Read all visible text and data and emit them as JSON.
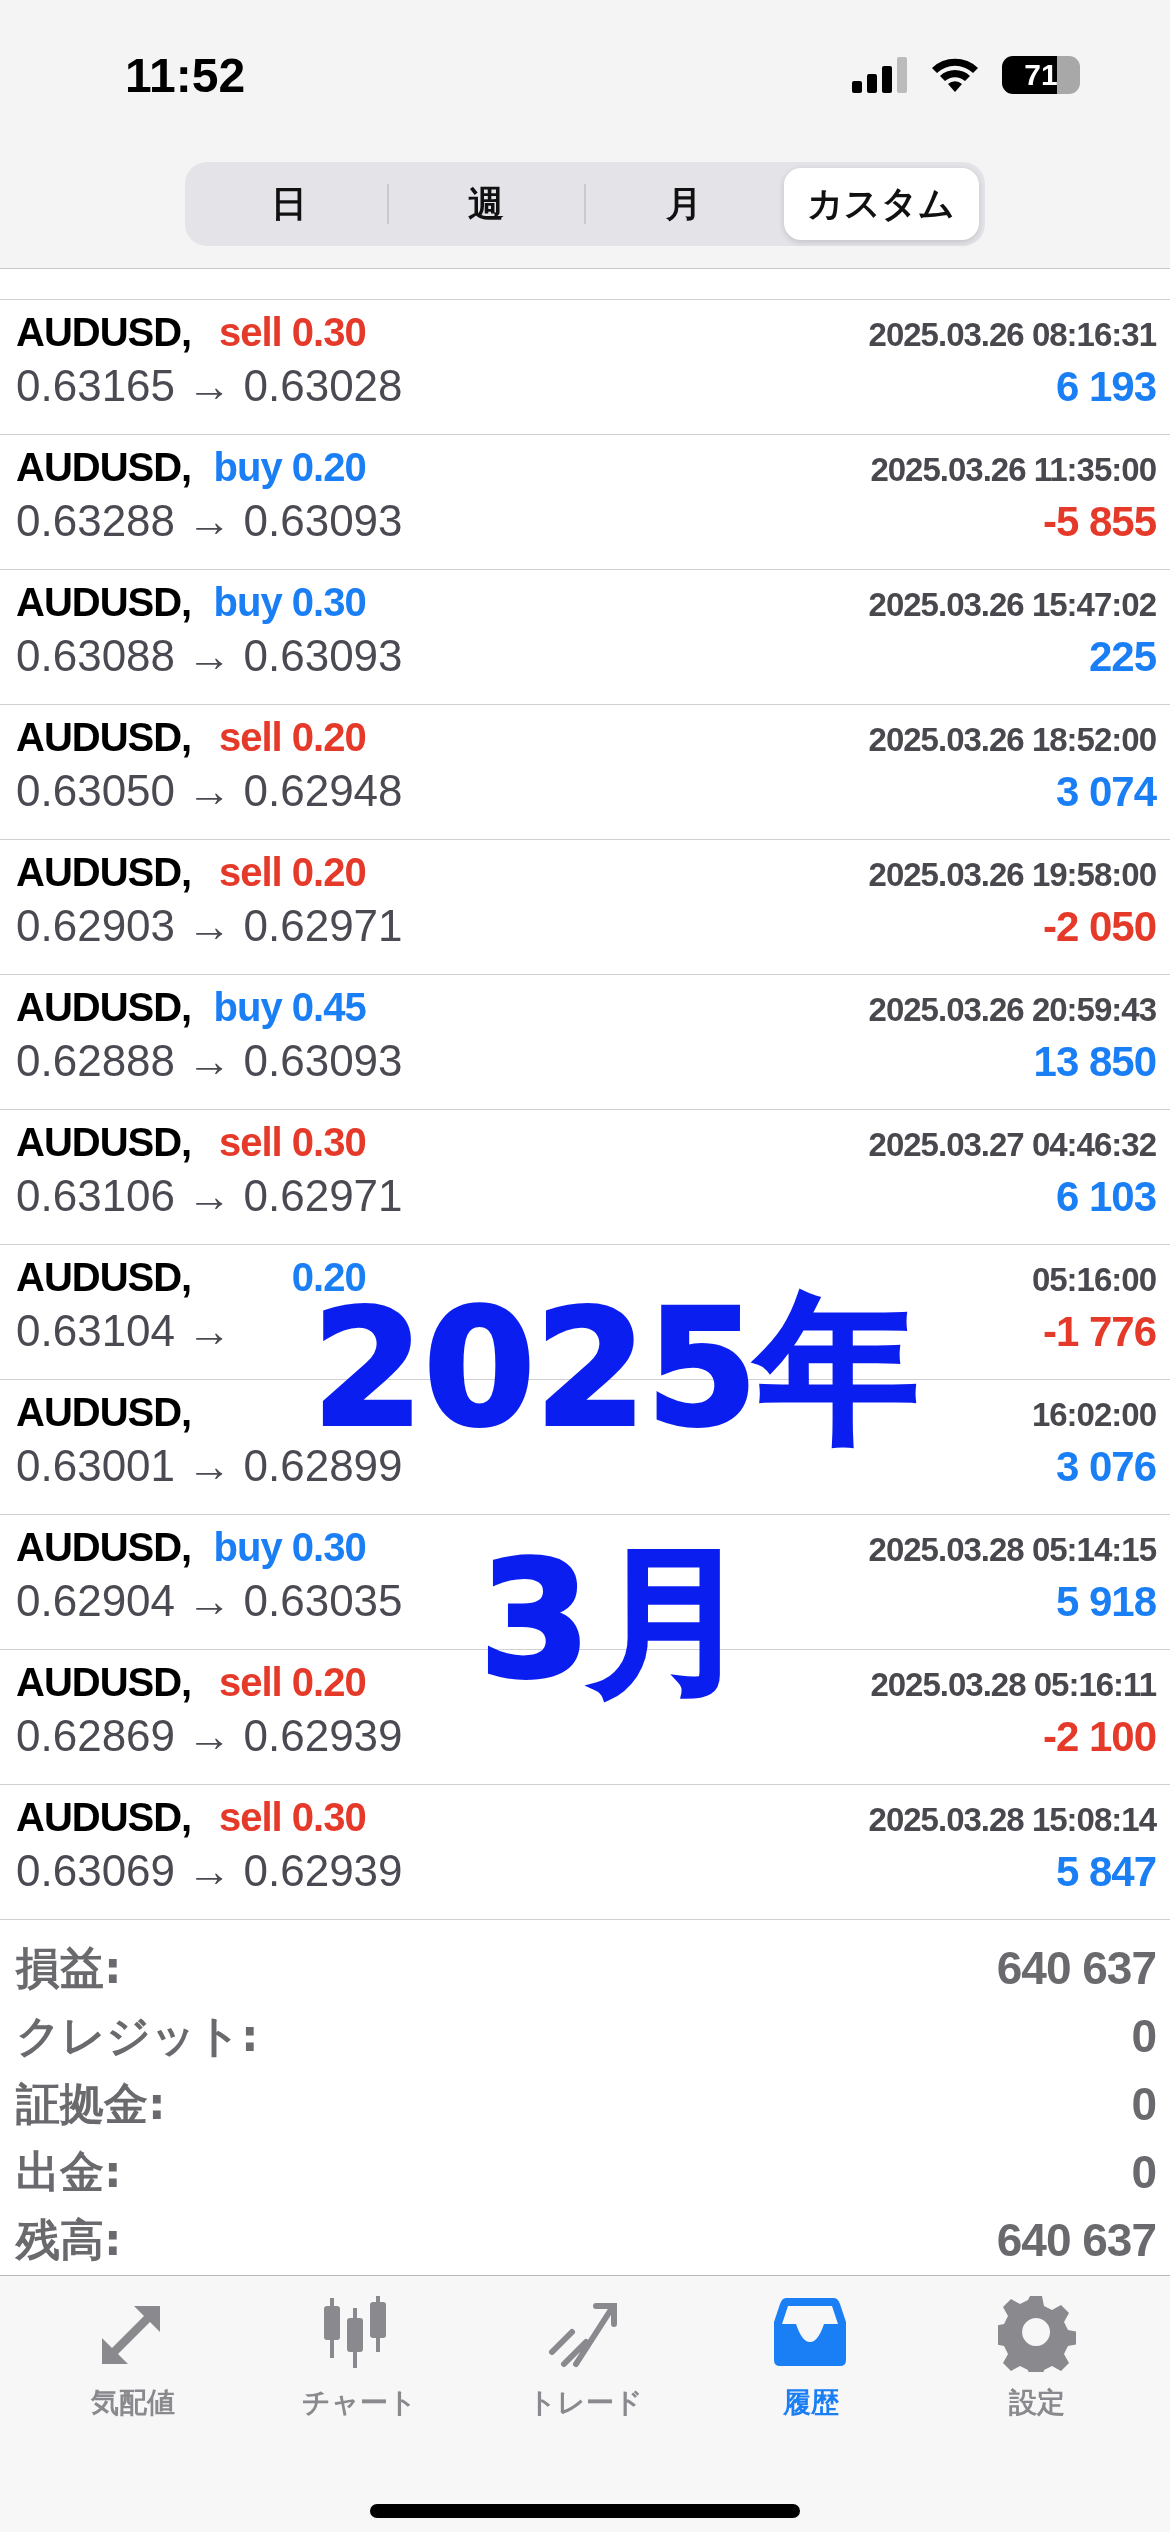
{
  "status_bar": {
    "time": "11:52",
    "battery": "71"
  },
  "period_tabs": [
    {
      "label": "日",
      "selected": false
    },
    {
      "label": "週",
      "selected": false
    },
    {
      "label": "月",
      "selected": false
    },
    {
      "label": "カスタム",
      "selected": true
    }
  ],
  "deals": [
    {
      "symbol": "AUDUSD,",
      "order": {
        "text": "sell 0.30",
        "color": "#e53a2a"
      },
      "time": "2025.03.26 08:16:31",
      "prices": "0.63165 → 0.63028",
      "result": {
        "text": "6 193",
        "color": "#1a7ef5"
      }
    },
    {
      "symbol": "AUDUSD,",
      "order": {
        "text": "buy 0.20",
        "color": "#1a7ef5"
      },
      "time": "2025.03.26 11:35:00",
      "prices": "0.63288 → 0.63093",
      "result": {
        "text": "-5 855",
        "color": "#e53a2a"
      }
    },
    {
      "symbol": "AUDUSD,",
      "order": {
        "text": "buy 0.30",
        "color": "#1a7ef5"
      },
      "time": "2025.03.26 15:47:02",
      "prices": "0.63088 → 0.63093",
      "result": {
        "text": "225",
        "color": "#1a7ef5"
      }
    },
    {
      "symbol": "AUDUSD,",
      "order": {
        "text": "sell 0.20",
        "color": "#e53a2a"
      },
      "time": "2025.03.26 18:52:00",
      "prices": "0.63050 → 0.62948",
      "result": {
        "text": "3 074",
        "color": "#1a7ef5"
      }
    },
    {
      "symbol": "AUDUSD,",
      "order": {
        "text": "sell 0.20",
        "color": "#e53a2a"
      },
      "time": "2025.03.26 19:58:00",
      "prices": "0.62903 → 0.62971",
      "result": {
        "text": "-2 050",
        "color": "#e53a2a"
      }
    },
    {
      "symbol": "AUDUSD,",
      "order": {
        "text": "buy 0.45",
        "color": "#1a7ef5"
      },
      "time": "2025.03.26 20:59:43",
      "prices": "0.62888 → 0.63093",
      "result": {
        "text": "13 850",
        "color": "#1a7ef5"
      }
    },
    {
      "symbol": "AUDUSD,",
      "order": {
        "text": "sell 0.30",
        "color": "#e53a2a"
      },
      "time": "2025.03.27 04:46:32",
      "prices": "0.63106 → 0.62971",
      "result": {
        "text": "6 103",
        "color": "#1a7ef5"
      }
    },
    {
      "symbol": "AUDUSD,",
      "order": {
        "text": "0.20",
        "color": "#1a7ef5"
      },
      "time": "05:16:00",
      "prices": "0.63104 →",
      "result": {
        "text": "-1 776",
        "color": "#e53a2a"
      }
    },
    {
      "symbol": "AUDUSD,",
      "time": "16:02:00",
      "prices": "0.63001 → 0.62899",
      "result": {
        "text": "3 076",
        "color": "#1a7ef5"
      }
    },
    {
      "symbol": "AUDUSD,",
      "order": {
        "text": "buy 0.30",
        "color": "#1a7ef5"
      },
      "time": "2025.03.28 05:14:15",
      "prices": "0.62904 → 0.63035",
      "result": {
        "text": "5 918",
        "color": "#1a7ef5"
      }
    },
    {
      "symbol": "AUDUSD,",
      "order": {
        "text": "sell 0.20",
        "color": "#e53a2a"
      },
      "time": "2025.03.28 05:16:11",
      "prices": "0.62869 → 0.62939",
      "result": {
        "text": "-2 100",
        "color": "#e53a2a"
      }
    },
    {
      "symbol": "AUDUSD,",
      "order": {
        "text": "sell 0.30",
        "color": "#e53a2a"
      },
      "time": "2025.03.28 15:08:14",
      "prices": "0.63069 → 0.62939",
      "result": {
        "text": "5 847",
        "color": "#1a7ef5"
      }
    }
  ],
  "summary": [
    {
      "label": "損益:",
      "value": "640 637"
    },
    {
      "label": "クレジット:",
      "value": "0"
    },
    {
      "label": "証拠金:",
      "value": "0"
    },
    {
      "label": "出金:",
      "value": "0"
    },
    {
      "label": "残高:",
      "value": "640 637"
    }
  ],
  "caption": {
    "lines": [
      "2025年",
      "3月"
    ]
  },
  "tab_bar": [
    {
      "label": "気配値",
      "selected": false
    },
    {
      "label": "チャート",
      "selected": false
    },
    {
      "label": "トレード",
      "selected": false
    },
    {
      "label": "履歴",
      "selected": true
    },
    {
      "label": "設定",
      "selected": false
    }
  ]
}
